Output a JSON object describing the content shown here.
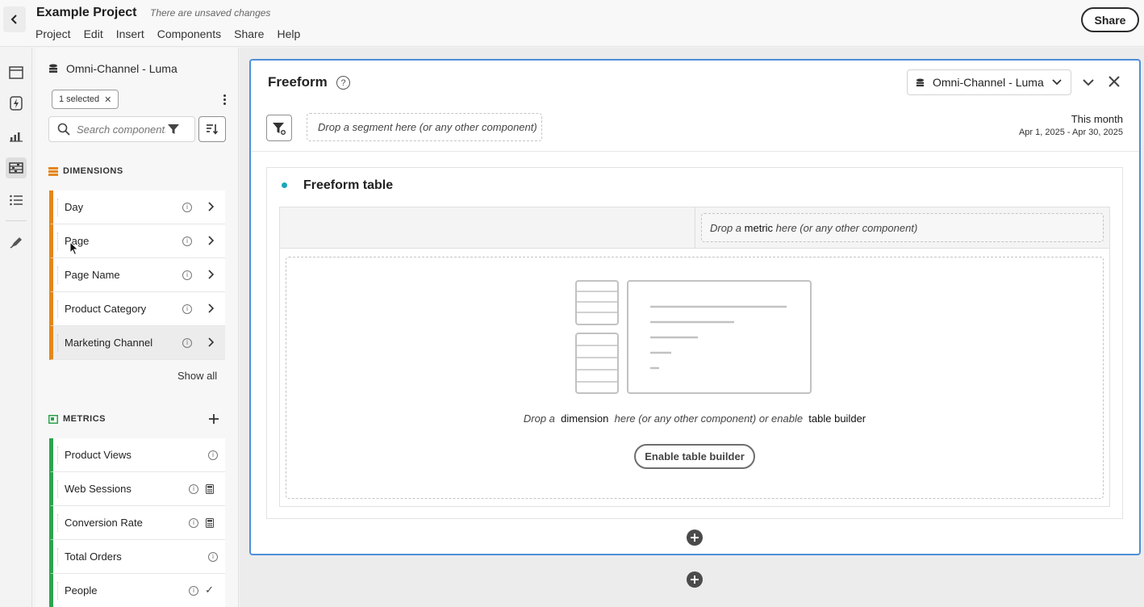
{
  "header": {
    "project_title": "Example Project",
    "unsaved_text": "There are unsaved changes",
    "menu": [
      "Project",
      "Edit",
      "Insert",
      "Components",
      "Share",
      "Help"
    ],
    "share_label": "Share"
  },
  "rail": {
    "icons": [
      "panels-icon",
      "visualizations-icon",
      "chart-icon",
      "components-icon",
      "list-icon",
      "brush-icon"
    ],
    "active": "components-icon"
  },
  "components_panel": {
    "data_source": "Omni-Channel - Luma",
    "selected_chip": "1 selected",
    "search_placeholder": "Search components",
    "dimensions_heading": "DIMENSIONS",
    "dimensions": [
      "Day",
      "Page",
      "Page Name",
      "Product Category",
      "Marketing Channel"
    ],
    "show_all": "Show all",
    "metrics_heading": "METRICS",
    "metrics": [
      {
        "label": "Product Views",
        "badge": ""
      },
      {
        "label": "Web Sessions",
        "badge": "calculator-icon"
      },
      {
        "label": "Conversion Rate",
        "badge": "calculator-icon"
      },
      {
        "label": "Total Orders",
        "badge": ""
      },
      {
        "label": "People",
        "badge": "check-icon"
      }
    ],
    "colors": {
      "dimension": "#e68619",
      "metric": "#2da44e"
    }
  },
  "freeform_panel": {
    "title": "Freeform",
    "data_source": "Omni-Channel - Luma",
    "segment_drop": "Drop a segment here (or any other component)",
    "date_label": "This month",
    "date_range": "Apr 1, 2025 - Apr 30, 2025",
    "viz_title": "Freeform table",
    "metric_drop_pre": "Drop a ",
    "metric_drop_bold": "metric",
    "metric_drop_post": " here (or any other component)",
    "dim_drop_pre": "Drop a ",
    "dim_drop_bold": "dimension",
    "dim_drop_mid": " here (or any other component) or enable ",
    "dim_drop_bold2": "table builder",
    "enable_button": "Enable table builder",
    "accent_color": "#4f8fd9"
  }
}
